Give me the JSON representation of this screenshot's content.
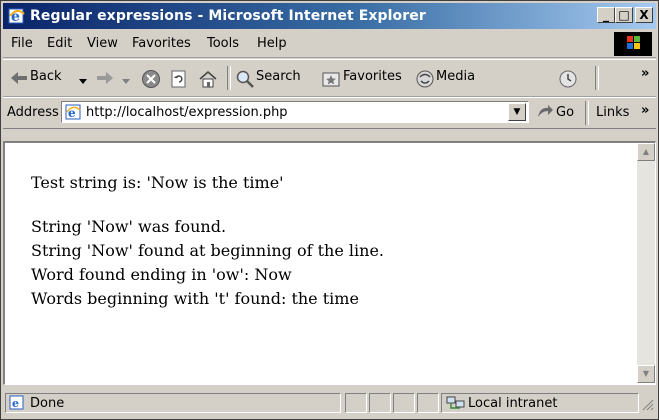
{
  "window": {
    "title": "Regular expressions - Microsoft Internet Explorer",
    "buttons": {
      "minimize": "_",
      "maximize": "□",
      "close": "X"
    }
  },
  "menu": [
    "File",
    "Edit",
    "View",
    "Favorites",
    "Tools",
    "Help"
  ],
  "toolbar": {
    "back": "Back",
    "search": "Search",
    "favorites": "Favorites",
    "media": "Media",
    "more": "»"
  },
  "address": {
    "label": "Address",
    "url": "http://localhost/expression.php",
    "go": "Go",
    "links": "Links",
    "links_more": "»"
  },
  "content": {
    "lines_top": [
      "Test string is: 'Now is the time'"
    ],
    "lines": [
      "String 'Now' was found.",
      "String 'Now' found at beginning of the line.",
      "Word found ending in 'ow': Now",
      "Words beginning with 't' found: the time"
    ]
  },
  "status": {
    "text": "Done",
    "zone": "Local intranet"
  },
  "colors": {
    "title_start": "#0a246a",
    "title_end": "#a6caf0",
    "chrome": "#d4d0c8"
  }
}
